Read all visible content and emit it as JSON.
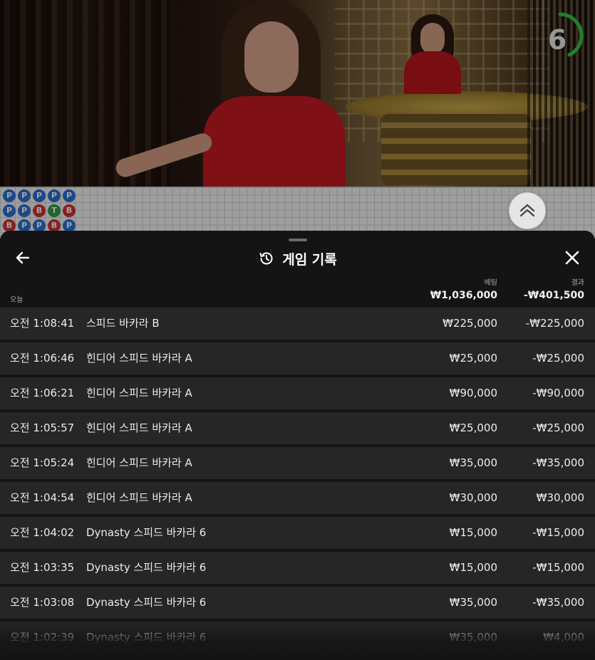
{
  "video": {
    "countdown": "6"
  },
  "road": {
    "beads": [
      [
        "P",
        "P",
        "P",
        "P",
        "P"
      ],
      [
        "P",
        "P",
        "B",
        "T",
        "B"
      ],
      [
        "B",
        "P",
        "P",
        "B",
        "P"
      ]
    ]
  },
  "panel": {
    "title": "게임 기록",
    "bet_header": "베팅",
    "result_header": "결과",
    "date_label": "오늘",
    "total_bet": "₩1,036,000",
    "total_result": "-₩401,500",
    "rows": [
      {
        "time": "오전 1:08:41",
        "game": "스피드 바카라 B",
        "bet": "₩225,000",
        "result": "-₩225,000"
      },
      {
        "time": "오전 1:06:46",
        "game": "힌디어 스피드 바카라 A",
        "bet": "₩25,000",
        "result": "-₩25,000"
      },
      {
        "time": "오전 1:06:21",
        "game": "힌디어 스피드 바카라 A",
        "bet": "₩90,000",
        "result": "-₩90,000"
      },
      {
        "time": "오전 1:05:57",
        "game": "힌디어 스피드 바카라 A",
        "bet": "₩25,000",
        "result": "-₩25,000"
      },
      {
        "time": "오전 1:05:24",
        "game": "힌디어 스피드 바카라 A",
        "bet": "₩35,000",
        "result": "-₩35,000"
      },
      {
        "time": "오전 1:04:54",
        "game": "힌디어 스피드 바카라 A",
        "bet": "₩30,000",
        "result": "₩30,000"
      },
      {
        "time": "오전 1:04:02",
        "game": "Dynasty 스피드 바카라 6",
        "bet": "₩15,000",
        "result": "-₩15,000"
      },
      {
        "time": "오전 1:03:35",
        "game": "Dynasty 스피드 바카라 6",
        "bet": "₩15,000",
        "result": "-₩15,000"
      },
      {
        "time": "오전 1:03:08",
        "game": "Dynasty 스피드 바카라 6",
        "bet": "₩35,000",
        "result": "-₩35,000"
      },
      {
        "time": "오전 1:02:39",
        "game": "Dynasty 스피드 바카라 6",
        "bet": "₩35,000",
        "result": "₩4,000"
      }
    ]
  },
  "colors": {
    "panel_bg": "#141414",
    "row_bg": "#262626",
    "timer_arc": "#35c24a",
    "bead_player": "#2b6fd1",
    "bead_banker": "#d13333",
    "bead_tie": "#2f9a4a"
  },
  "icons": {
    "back": "arrow-left-icon",
    "history": "history-clock-icon",
    "close": "close-icon",
    "expand": "double-chevron-up-icon"
  }
}
